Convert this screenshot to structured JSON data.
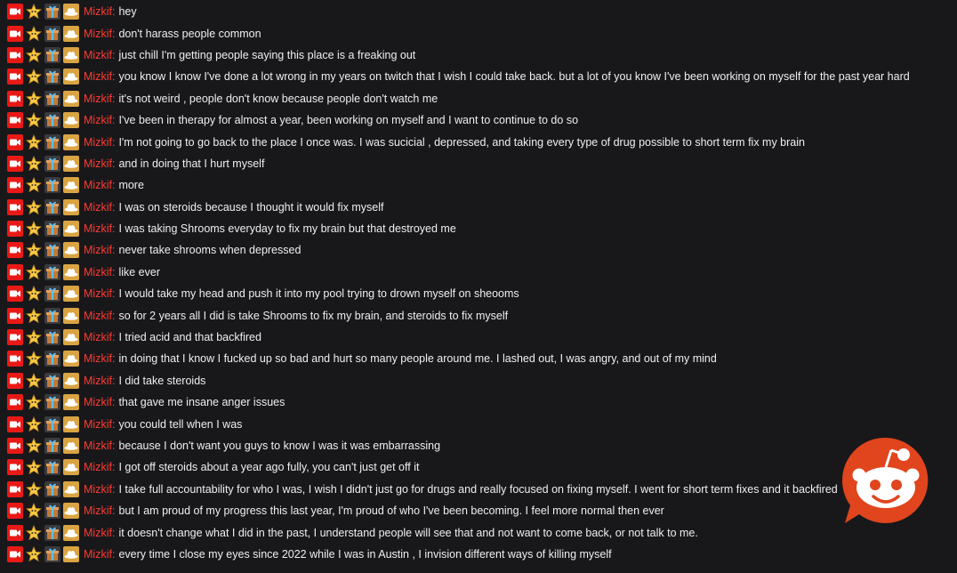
{
  "chat": {
    "username": "Mizkif",
    "separator": ":",
    "badges": [
      "broadcaster-camera-icon",
      "star-badge-icon",
      "gift-badge-icon",
      "cowboy-hat-badge-icon"
    ],
    "messages": [
      "hey",
      "don't harass people common",
      "just chill I'm getting people saying this place is a freaking out",
      "you know I know I've done a lot wrong in my years on twitch that I wish I could take back. but a lot of you know I've been working on myself for the past year hard",
      "it's not weird , people don't know because people don't watch me",
      "I've been in therapy for almost a year, been working on myself and I want to continue to do so",
      "I'm not going to go back to the place I once was. I was sucicial , depressed, and taking every type of drug possible to short term fix my brain",
      "and in doing that I hurt myself",
      "more",
      "I was on steroids because I thought it would fix myself",
      "I was taking Shrooms everyday to fix my brain but that destroyed me",
      "never take shrooms when depressed",
      "like ever",
      "I would take my head and push it into my pool trying to drown myself on sheooms",
      "so for 2 years all I did is take Shrooms to fix my brain, and steroids to fix myself",
      "I tried acid and that backfired",
      "in doing that I know I fucked up so bad and hurt so many people around me. I lashed out, I was angry, and out of my mind",
      "I did take steroids",
      "that gave me insane anger issues",
      "you could tell when I was",
      "because I don't want you guys to know I was it was embarrassing",
      "I got off steroids about a year ago fully, you can't just get off it",
      "I take full accountability for who I was, I wish I didn't just go for drugs and really focused on fixing myself. I went for short term fixes and it backfired",
      "but I am proud of my progress this last year, I'm proud of who I've been becoming. I feel more normal then ever",
      "it doesn't change what I did in the past, I understand people will see that and not want to come back, or not talk to me.",
      "every time I close my eyes since 2022 while I was in Austin , I invision different ways of killing myself"
    ]
  },
  "colors": {
    "background": "#18181b",
    "username": "#ff3b30",
    "message": "#efeff1",
    "reddit_orange": "#ff4500"
  },
  "watermark": {
    "icon": "reddit-logo-icon"
  }
}
